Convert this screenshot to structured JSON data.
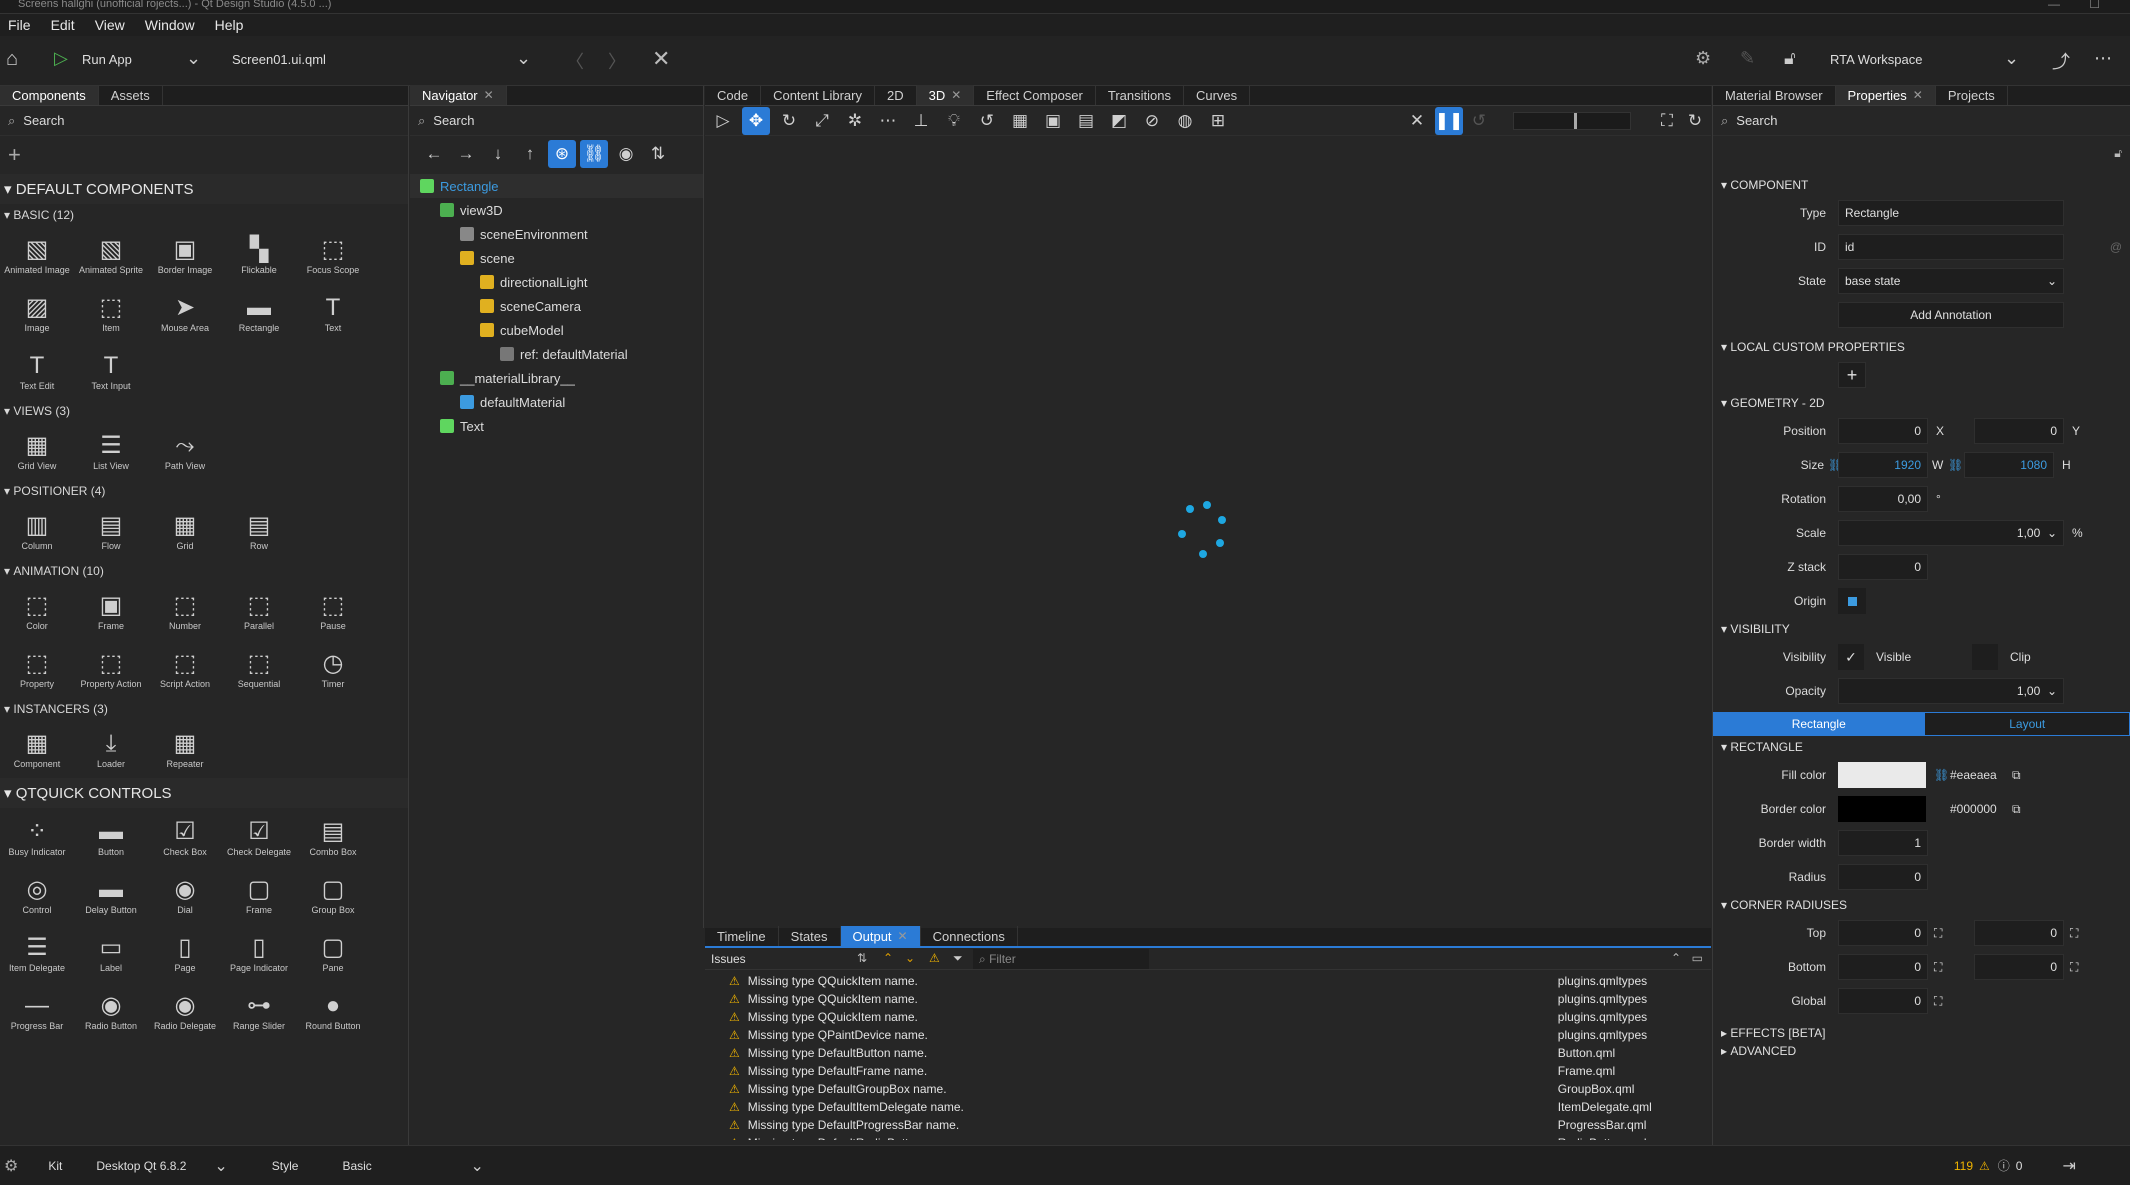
{
  "window": {
    "title": "Screens hallghi (unofficial rojects...) - Qt Design Studio (4.5.0 ...)"
  },
  "menu": [
    "File",
    "Edit",
    "View",
    "Window",
    "Help"
  ],
  "toolbar": {
    "run_label": "Run App",
    "file": "Screen01.ui.qml",
    "workspace": "RTA Workspace"
  },
  "left_tabs": [
    "Components",
    "Assets"
  ],
  "search_placeholder": "Search",
  "components": {
    "header": "DEFAULT COMPONENTS",
    "groups": [
      {
        "title": "BASIC (12)",
        "items": [
          [
            "Animated Image",
            "▧"
          ],
          [
            "Animated Sprite",
            "▧"
          ],
          [
            "Border Image",
            "▣"
          ],
          [
            "Flickable",
            "▚"
          ],
          [
            "Focus Scope",
            "⬚"
          ],
          [
            "Image",
            "▨"
          ],
          [
            "Item",
            "⬚"
          ],
          [
            "Mouse Area",
            "➤"
          ],
          [
            "Rectangle",
            "▬"
          ],
          [
            "Text",
            "T"
          ],
          [
            "Text Edit",
            "T"
          ],
          [
            "Text Input",
            "T"
          ]
        ]
      },
      {
        "title": "VIEWS (3)",
        "items": [
          [
            "Grid View",
            "▦"
          ],
          [
            "List View",
            "☰"
          ],
          [
            "Path View",
            "⤳"
          ]
        ]
      },
      {
        "title": "POSITIONER (4)",
        "items": [
          [
            "Column",
            "▥"
          ],
          [
            "Flow",
            "▤"
          ],
          [
            "Grid",
            "▦"
          ],
          [
            "Row",
            "▤"
          ]
        ]
      },
      {
        "title": "ANIMATION (10)",
        "items": [
          [
            "Color",
            "⬚"
          ],
          [
            "Frame",
            "▣"
          ],
          [
            "Number",
            "⬚"
          ],
          [
            "Parallel",
            "⬚"
          ],
          [
            "Pause",
            "⬚"
          ],
          [
            "Property",
            "⬚"
          ],
          [
            "Property Action",
            "⬚"
          ],
          [
            "Script Action",
            "⬚"
          ],
          [
            "Sequential",
            "⬚"
          ],
          [
            "Timer",
            "◷"
          ]
        ]
      },
      {
        "title": "INSTANCERS (3)",
        "items": [
          [
            "Component",
            "▦"
          ],
          [
            "Loader",
            "⤓"
          ],
          [
            "Repeater",
            "▦"
          ]
        ]
      }
    ],
    "header2": "QTQUICK CONTROLS",
    "controls": [
      [
        "Busy Indicator",
        "⁘"
      ],
      [
        "Button",
        "▬"
      ],
      [
        "Check Box",
        "☑"
      ],
      [
        "Check Delegate",
        "☑"
      ],
      [
        "Combo Box",
        "▤"
      ],
      [
        "Control",
        "◎"
      ],
      [
        "Delay Button",
        "▬"
      ],
      [
        "Dial",
        "◉"
      ],
      [
        "Frame",
        "▢"
      ],
      [
        "Group Box",
        "▢"
      ],
      [
        "Item Delegate",
        "☰"
      ],
      [
        "Label",
        "▭"
      ],
      [
        "Page",
        "▯"
      ],
      [
        "Page Indicator",
        "▯"
      ],
      [
        "Pane",
        "▢"
      ],
      [
        "Progress Bar",
        "—"
      ],
      [
        "Radio Button",
        "◉"
      ],
      [
        "Radio Delegate",
        "◉"
      ],
      [
        "Range Slider",
        "⊶"
      ],
      [
        "Round Button",
        "●"
      ]
    ]
  },
  "navigator": {
    "tab": "Navigator",
    "items": [
      {
        "label": "Rectangle",
        "indent": 0,
        "color": "#5fd65f",
        "selected": true
      },
      {
        "label": "view3D",
        "indent": 1,
        "color": "#4caf50"
      },
      {
        "label": "sceneEnvironment",
        "indent": 2,
        "color": "#888888"
      },
      {
        "label": "scene",
        "indent": 2,
        "color": "#e0b020"
      },
      {
        "label": "directionalLight",
        "indent": 3,
        "color": "#e0b020"
      },
      {
        "label": "sceneCamera",
        "indent": 3,
        "color": "#e0b020"
      },
      {
        "label": "cubeModel",
        "indent": 3,
        "color": "#e0b020"
      },
      {
        "label": "ref: defaultMaterial",
        "indent": 4,
        "color": "#777777"
      },
      {
        "label": "__materialLibrary__",
        "indent": 1,
        "color": "#4caf50"
      },
      {
        "label": "defaultMaterial",
        "indent": 2,
        "color": "#3c9be0"
      },
      {
        "label": "Text",
        "indent": 1,
        "color": "#5fd65f"
      }
    ]
  },
  "center_tabs": [
    "Code",
    "Content Library",
    "2D",
    "3D",
    "Effect Composer",
    "Transitions",
    "Curves"
  ],
  "bottom_tabs": [
    "Timeline",
    "States",
    "Output",
    "Connections"
  ],
  "output": {
    "title": "Issues",
    "filter_placeholder": "Filter",
    "rows": [
      [
        "Missing type QQuickItem name.",
        "plugins.qmltypes"
      ],
      [
        "Missing type QQuickItem name.",
        "plugins.qmltypes"
      ],
      [
        "Missing type QQuickItem name.",
        "plugins.qmltypes"
      ],
      [
        "Missing type QPaintDevice name.",
        "plugins.qmltypes"
      ],
      [
        "Missing type DefaultButton name.",
        "Button.qml"
      ],
      [
        "Missing type DefaultFrame name.",
        "Frame.qml"
      ],
      [
        "Missing type DefaultGroupBox name.",
        "GroupBox.qml"
      ],
      [
        "Missing type DefaultItemDelegate name.",
        "ItemDelegate.qml"
      ],
      [
        "Missing type DefaultProgressBar name.",
        "ProgressBar.qml"
      ],
      [
        "Missing type DefaultRadioButton name.",
        "RadioButton.qml"
      ]
    ]
  },
  "right_tabs": [
    "Material Browser",
    "Properties",
    "Projects"
  ],
  "props": {
    "component": "COMPONENT",
    "type_label": "Type",
    "type": "Rectangle",
    "id_label": "ID",
    "id": "id",
    "state_label": "State",
    "state": "base state",
    "annot": "Add Annotation",
    "local": "LOCAL CUSTOM PROPERTIES",
    "geometry": "GEOMETRY - 2D",
    "pos_label": "Position",
    "x": "0",
    "y": "0",
    "xl": "X",
    "yl": "Y",
    "size_label": "Size",
    "w": "1920",
    "h": "1080",
    "wl": "W",
    "hl": "H",
    "rot_label": "Rotation",
    "rot": "0,00",
    "deg": "°",
    "scale_label": "Scale",
    "scale": "1,00",
    "pct": "%",
    "z_label": "Z stack",
    "z": "0",
    "origin_label": "Origin",
    "visibility": "VISIBILITY",
    "vis_label": "Visibility",
    "visible": "Visible",
    "clip": "Clip",
    "opacity_label": "Opacity",
    "opacity": "1,00",
    "subtab1": "Rectangle",
    "subtab2": "Layout",
    "rect": "RECTANGLE",
    "fill_label": "Fill color",
    "fill": "#eaeaea",
    "border_label": "Border color",
    "border": "#000000",
    "bw_label": "Border width",
    "bw": "1",
    "radius_label": "Radius",
    "radius": "0",
    "corner": "CORNER RADIUSES",
    "top_label": "Top",
    "bottom_label": "Bottom",
    "global_label": "Global",
    "effects": "EFFECTS [BETA]",
    "advanced": "ADVANCED"
  },
  "status": {
    "kit_label": "Kit",
    "kit": "Desktop Qt 6.8.2",
    "style_label": "Style",
    "style": "Basic",
    "warnings": "119",
    "errors": "0"
  }
}
